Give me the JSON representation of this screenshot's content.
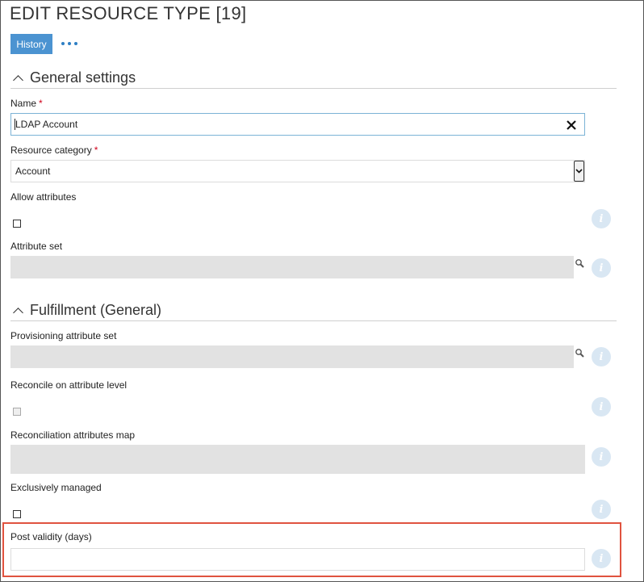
{
  "header": {
    "title": "EDIT RESOURCE TYPE [19]"
  },
  "toolbar": {
    "history_label": "History",
    "more_icon": "more-horizontal-icon"
  },
  "sections": {
    "general": {
      "title": "General settings"
    },
    "fulfillment": {
      "title": "Fulfillment (General)"
    }
  },
  "fields": {
    "name": {
      "label": "Name",
      "required_mark": "*",
      "value": "LDAP Account"
    },
    "resource_category": {
      "label": "Resource category",
      "required_mark": "*",
      "value": "Account"
    },
    "allow_attributes": {
      "label": "Allow attributes",
      "checked": false
    },
    "attribute_set": {
      "label": "Attribute set",
      "value": ""
    },
    "provisioning_attribute_set": {
      "label": "Provisioning attribute set",
      "value": ""
    },
    "reconcile_on_attribute_level": {
      "label": "Reconcile on attribute level",
      "checked": false,
      "disabled": true
    },
    "reconciliation_attributes_map": {
      "label": "Reconciliation attributes map",
      "value": ""
    },
    "exclusively_managed": {
      "label": "Exclusively managed",
      "checked": false
    },
    "post_validity_days": {
      "label": "Post validity (days)",
      "value": ""
    }
  },
  "info_icon_glyph": "i",
  "colors": {
    "accent": "#4b93d1",
    "highlight": "#e0533f",
    "required": "#d0021b",
    "disabled_bg": "#e2e2e2"
  }
}
